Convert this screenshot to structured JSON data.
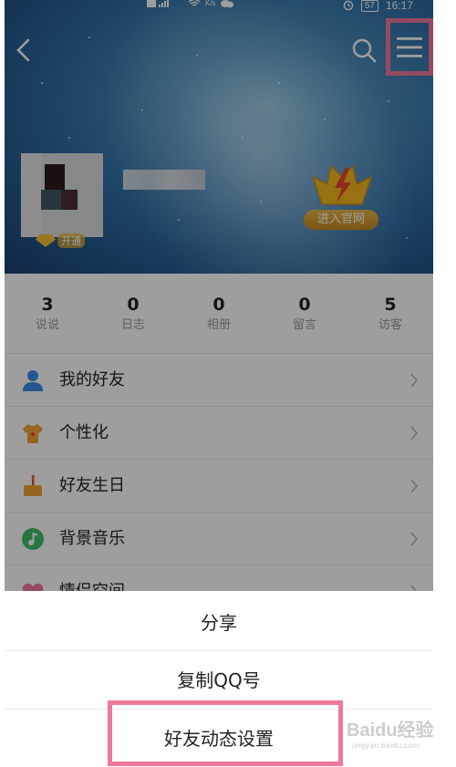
{
  "status_bar": {
    "net_speed": "K/s",
    "battery": "57",
    "time": "16:17"
  },
  "profile": {
    "vip_label": "开通",
    "official_site_label": "进入官网"
  },
  "stats": [
    {
      "value": "3",
      "label": "说说"
    },
    {
      "value": "0",
      "label": "日志"
    },
    {
      "value": "0",
      "label": "相册"
    },
    {
      "value": "0",
      "label": "留言"
    },
    {
      "value": "5",
      "label": "访客"
    }
  ],
  "menu": {
    "items": [
      {
        "label": "我的好友",
        "icon": "friends-icon",
        "color": "#3b8fe8"
      },
      {
        "label": "个性化",
        "icon": "tshirt-icon",
        "color": "#f2a33a"
      },
      {
        "label": "好友生日",
        "icon": "cake-icon",
        "color": "#f0a530"
      },
      {
        "label": "背景音乐",
        "icon": "music-note-icon",
        "color": "#3fbf6a"
      },
      {
        "label": "情侣空间",
        "icon": "heart-icon",
        "color": "#f07aa0"
      }
    ]
  },
  "action_sheet": {
    "share_label": "分享",
    "copy_qq_label": "复制QQ号",
    "feed_settings_label": "好友动态设置"
  },
  "watermark": {
    "brand": "Baidu经验",
    "url": "jingyan.baidu.com"
  },
  "colors": {
    "highlight": "#f0789a",
    "overlay": "rgba(0,0,0,0.38)"
  }
}
